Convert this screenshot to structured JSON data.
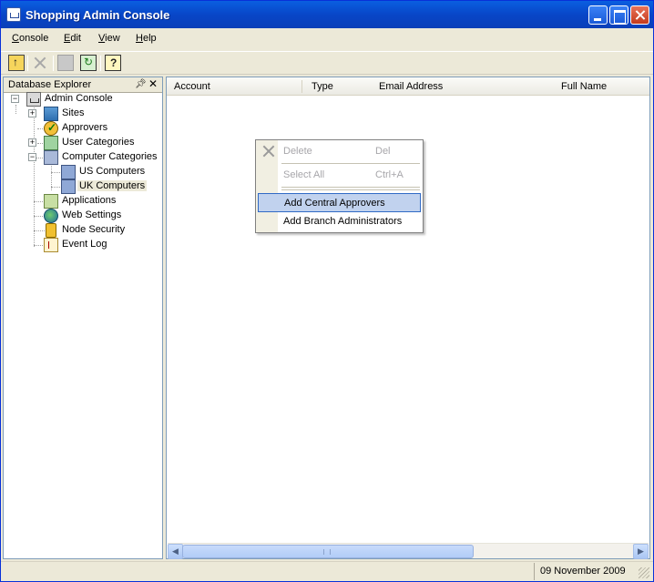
{
  "window": {
    "title": "Shopping Admin Console"
  },
  "menubar": {
    "items": [
      "Console",
      "Edit",
      "View",
      "Help"
    ]
  },
  "toolbar": {
    "icons": [
      "up-folder-icon",
      "delete-icon",
      "properties-icon",
      "refresh-icon",
      "help-icon"
    ]
  },
  "explorer": {
    "title": "Database Explorer",
    "nodes": [
      {
        "label": "Admin Console",
        "icon": "admin-console-icon",
        "expander": "−"
      },
      {
        "label": "Sites",
        "icon": "sites-icon",
        "expander": "+"
      },
      {
        "label": "Approvers",
        "icon": "approvers-icon",
        "expander": ""
      },
      {
        "label": "User Categories",
        "icon": "user-categories-icon",
        "expander": "+"
      },
      {
        "label": "Computer Categories",
        "icon": "computer-categories-icon",
        "expander": "−"
      },
      {
        "label": "US Computers",
        "icon": "us-computers-icon",
        "expander": ""
      },
      {
        "label": "UK Computers",
        "icon": "uk-computers-icon",
        "expander": ""
      },
      {
        "label": "Applications",
        "icon": "applications-icon",
        "expander": ""
      },
      {
        "label": "Web Settings",
        "icon": "web-settings-icon",
        "expander": ""
      },
      {
        "label": "Node Security",
        "icon": "node-security-icon",
        "expander": ""
      },
      {
        "label": "Event Log",
        "icon": "event-log-icon",
        "expander": ""
      }
    ]
  },
  "list": {
    "columns": [
      "Account",
      "Type",
      "Email Address",
      "Full Name"
    ]
  },
  "context_menu": {
    "items": [
      {
        "label": "Delete",
        "shortcut": "Del",
        "enabled": false
      },
      {
        "label": "Select All",
        "shortcut": "Ctrl+A",
        "enabled": false
      },
      {
        "label": "Add Central Approvers",
        "shortcut": "",
        "enabled": true,
        "highlighted": true
      },
      {
        "label": "Add Branch Administrators",
        "shortcut": "",
        "enabled": true
      }
    ]
  },
  "status": {
    "date": "09 November 2009"
  },
  "colors": {
    "titlebar": "#0846c8",
    "highlight": "#c1d2ee",
    "face": "#ece9d8"
  }
}
